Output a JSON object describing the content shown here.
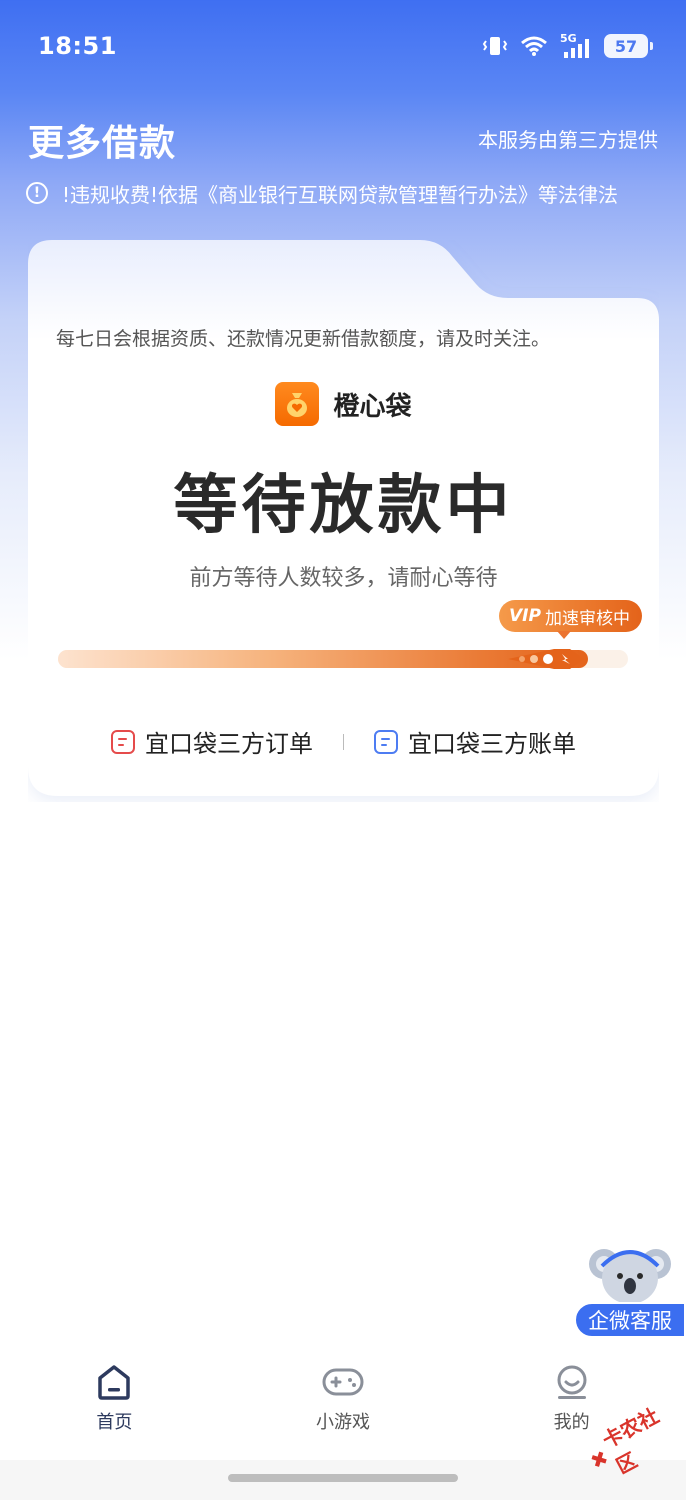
{
  "status_bar": {
    "time": "18:51",
    "network": "5G",
    "battery": "57"
  },
  "header": {
    "title": "更多借款",
    "provider_note": "本服务由第三方提供",
    "notice": "!违规收费!依据《商业银行互联网贷款管理暂行办法》等法律法"
  },
  "card": {
    "tip": "每七日会根据资质、还款情况更新借款额度，请及时关注。",
    "brand_name": "橙心袋",
    "status_title": "等待放款中",
    "status_sub": "前方等待人数较多，请耐心等待",
    "vip_mark": "VIP",
    "vip_label": "加速审核中",
    "progress": 0.93,
    "links": [
      {
        "label": "宜口袋三方订单",
        "icon": "order-icon",
        "color": "#e54b4b"
      },
      {
        "label": "宜口袋三方账单",
        "icon": "bill-icon",
        "color": "#4d7cf2"
      }
    ]
  },
  "service": {
    "label": "企微客服",
    "icon": "koala-mascot-icon"
  },
  "nav": {
    "items": [
      {
        "label": "首页",
        "icon": "home-icon",
        "active": true
      },
      {
        "label": "小游戏",
        "icon": "gamepad-icon",
        "active": false
      },
      {
        "label": "我的",
        "icon": "profile-icon",
        "active": false
      }
    ]
  },
  "watermark": "卡农社区",
  "colors": {
    "brand_blue": "#3f6ff2",
    "accent_orange": "#e4631a",
    "text_dark": "#2a2a2a"
  }
}
